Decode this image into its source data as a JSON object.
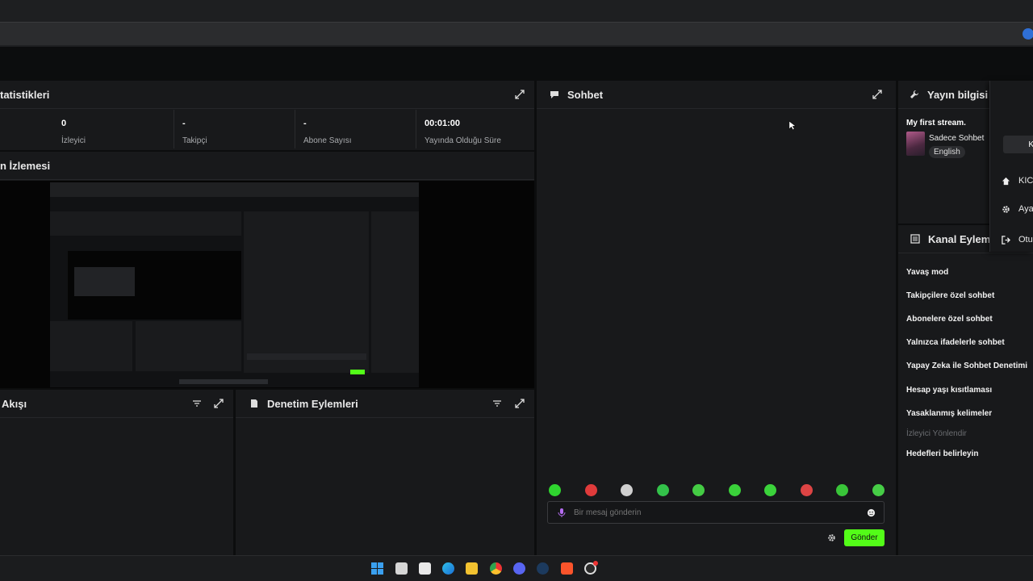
{
  "stats_panel": {
    "title": "tatistikleri",
    "stats": [
      {
        "value": "0",
        "label": "İzleyici"
      },
      {
        "value": "-",
        "label": "Takipçi"
      },
      {
        "value": "-",
        "label": "Abone Sayısı"
      },
      {
        "value": "00:01:00",
        "label": "Yayında Olduğu Süre"
      }
    ]
  },
  "preview_panel": {
    "title": "n İzlemesi"
  },
  "activity_panel": {
    "title": "Akışı"
  },
  "mod_actions_panel": {
    "title": "Denetim Eylemleri"
  },
  "chat_panel": {
    "title": "Sohbet",
    "input_placeholder": "Bir mesaj gönderin",
    "send_label": "Gönder",
    "emote_colors": [
      "#2fd52f",
      "#e03b3b",
      "#cfcfcf",
      "#33c24a",
      "#44cc44",
      "#3ad13a",
      "#3bd33b",
      "#d44",
      "#39c539",
      "#46cd46"
    ]
  },
  "stream_info": {
    "title": "Yayın bilgisi",
    "stream_title": "My first stream.",
    "category": "Sadece Sohbet",
    "language": "English"
  },
  "channel_actions": {
    "title": "Kanal Eylemle",
    "items": [
      {
        "label": "Yavaş mod",
        "disabled": false
      },
      {
        "label": "Takipçilere özel sohbet",
        "disabled": false
      },
      {
        "label": "Abonelere özel sohbet",
        "disabled": false
      },
      {
        "label": "Yalnızca ifadelerle sohbet",
        "disabled": false
      },
      {
        "label": "Yapay Zeka ile Sohbet Denetimi",
        "disabled": false
      },
      {
        "label": "Hesap yaşı kısıtlaması",
        "disabled": false
      },
      {
        "label": "Yasaklanmış kelimeler",
        "disabled": false
      },
      {
        "label": "İzleyici Yönlendir",
        "disabled": true
      },
      {
        "label": "Hedefleri belirleyin",
        "disabled": false
      }
    ]
  },
  "user_menu": {
    "top_button": "K",
    "items": [
      {
        "label": "KIC",
        "icon": "home-icon"
      },
      {
        "label": "Aya",
        "icon": "gear-icon"
      },
      {
        "label": "Otu",
        "icon": "logout-icon"
      }
    ]
  },
  "colors": {
    "accent": "#53fc18",
    "panel": "#18191b",
    "background": "#0c0d0e"
  }
}
